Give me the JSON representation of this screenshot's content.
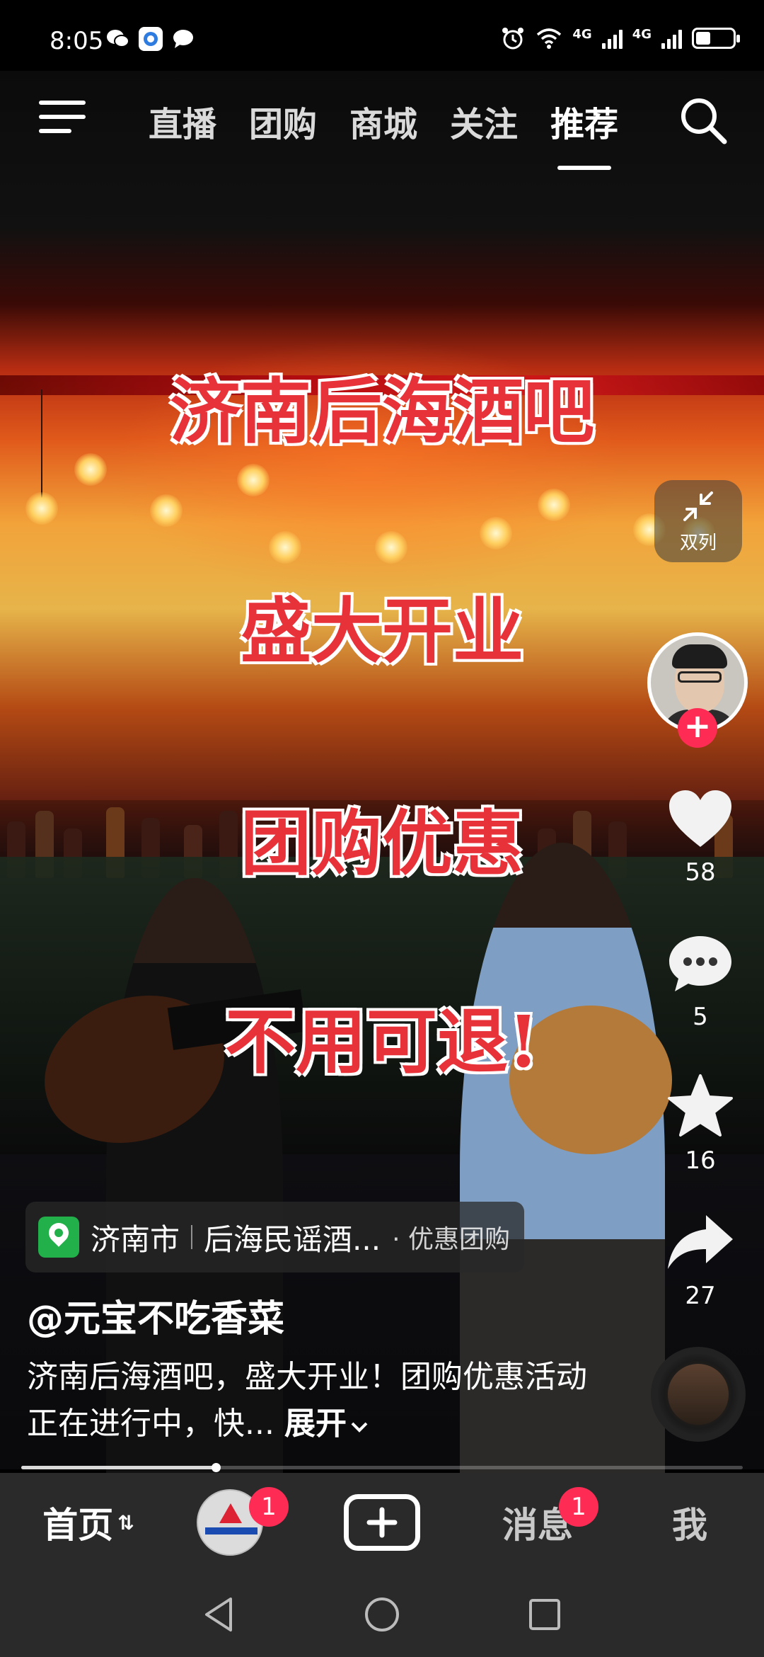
{
  "status_bar": {
    "time": "8:05",
    "network_1": "4G",
    "network_2": "4G",
    "battery_level": 0.35
  },
  "top_nav": {
    "tabs": [
      {
        "label": "直播",
        "active": false
      },
      {
        "label": "团购",
        "active": false
      },
      {
        "label": "商城",
        "active": false
      },
      {
        "label": "关注",
        "active": false
      },
      {
        "label": "推荐",
        "active": true
      }
    ],
    "menu_icon": "menu-icon",
    "search_icon": "search-icon"
  },
  "video": {
    "overlay_lines": [
      "济南后海酒吧",
      "盛大开业",
      "团购优惠",
      "不用可退!"
    ]
  },
  "right_rail": {
    "dual_column_label": "双列",
    "like_count": "58",
    "comment_count": "5",
    "favorite_count": "16",
    "share_count": "27"
  },
  "poi": {
    "city": "济南市",
    "name": "后海民谣酒...",
    "tag": "· 优惠团购"
  },
  "post": {
    "author": "@元宝不吃香菜",
    "description": "济南后海酒吧，盛大开业！团购优惠活动正在进行中，快...",
    "expand_label": "展开"
  },
  "progress": {
    "fraction": 0.27
  },
  "tab_bar": {
    "home_label": "首页",
    "friend_badge": "1",
    "message_label": "消息",
    "message_badge": "1",
    "me_label": "我"
  },
  "colors": {
    "accent": "#fe2c55",
    "overlay_text": "#e8323a",
    "poi_green": "#21b04a",
    "tab_bar_bg": "#2a2a2a"
  }
}
